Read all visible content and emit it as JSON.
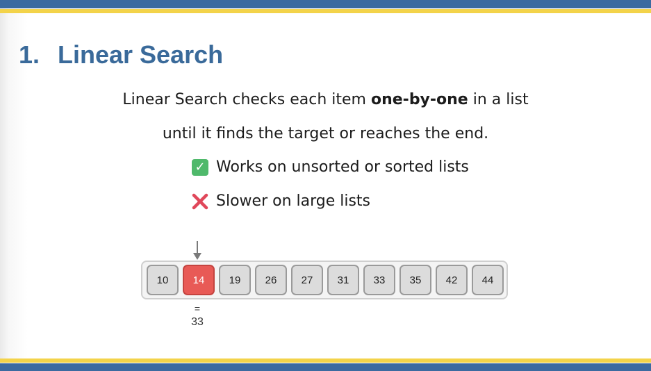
{
  "title": {
    "number": "1.",
    "text": "Linear Search"
  },
  "description": {
    "line1_before": "Linear Search checks each item ",
    "line1_bold": "one-by-one",
    "line1_after": " in a list",
    "line2": "until it finds the target or reaches the end."
  },
  "bullets": [
    {
      "icon": "check-mark-icon",
      "text": "Works on unsorted or sorted lists"
    },
    {
      "icon": "cross-mark-icon",
      "text": "Slower on large lists"
    }
  ],
  "array": {
    "values": [
      "10",
      "14",
      "19",
      "26",
      "27",
      "31",
      "33",
      "35",
      "42",
      "44"
    ],
    "active_index": 1,
    "compare_symbol": "=",
    "target": "33"
  },
  "colors": {
    "title": "#3a6a9a",
    "bar_blue": "#3b6aa0",
    "bar_yellow": "#f3d34a",
    "active_cell": "#e85a56",
    "cell": "#dcdcdc",
    "check_icon": "#4fb96b",
    "cross_icon": "#e0475a"
  }
}
